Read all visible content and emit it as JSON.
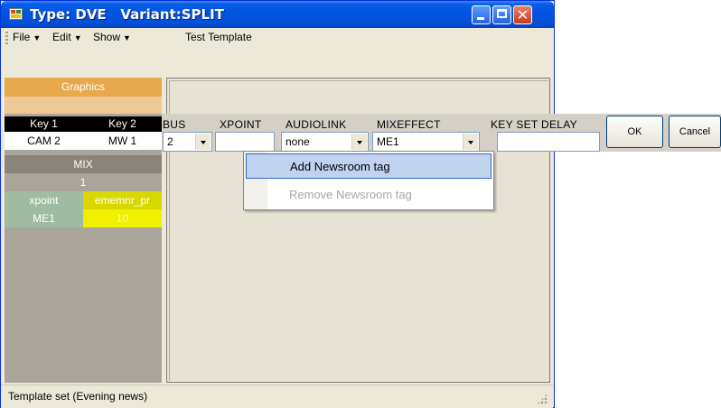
{
  "window": {
    "title": "Type: DVE   Variant:SPLIT",
    "controls": {
      "minimize": "minimize-icon",
      "maximize": "maximize-icon",
      "close": "close-icon"
    }
  },
  "menubar": {
    "items": [
      {
        "label": "File",
        "has_dropdown": true
      },
      {
        "label": "Edit",
        "has_dropdown": true
      },
      {
        "label": "Show",
        "has_dropdown": true
      },
      {
        "label": "Test Template",
        "has_dropdown": false
      }
    ]
  },
  "left_panel": {
    "graphics_label": "Graphics",
    "keys": {
      "key1_header": "Key 1",
      "key2_header": "Key 2",
      "key1_value": "CAM 2",
      "key2_value": "MW 1"
    },
    "mix_label": "MIX",
    "mix_value": "1",
    "xpoint_header": "xpoint",
    "ememnr_header": "ememnr_pr",
    "xpoint_value": "ME1",
    "ememnr_value": "10"
  },
  "fields": {
    "bus": {
      "label": "BUS",
      "value": "2"
    },
    "xpoint": {
      "label": "XPOINT",
      "value": ""
    },
    "audiolink": {
      "label": "AUDIOLINK",
      "value": "none"
    },
    "mixeffect": {
      "label": "MIXEFFECT",
      "value": "ME1"
    },
    "key_set_delay": {
      "label": "KEY SET DELAY",
      "value": ""
    }
  },
  "buttons": {
    "ok": "OK",
    "cancel": "Cancel"
  },
  "context_menu": {
    "items": [
      {
        "label": "Add Newsroom tag",
        "enabled": true,
        "highlighted": true
      },
      {
        "label": "Remove Newsroom tag",
        "enabled": false,
        "highlighted": false
      }
    ]
  },
  "status_bar": {
    "text": "Template set (Evening news)"
  },
  "colors": {
    "titlebar": "#0054e3",
    "graphics_bg": "#e8a84c",
    "graphics_sub": "#f0c898",
    "key_header_bg": "#000000",
    "mix_bg": "#8a847a",
    "mix_value_bg": "#aaa49a",
    "xpoint_bg": "#9fbca2",
    "ememnr_bg": "#d8d800",
    "ememnr_value_bg": "#f0f000",
    "menu_highlight": "#c1d2ee"
  }
}
